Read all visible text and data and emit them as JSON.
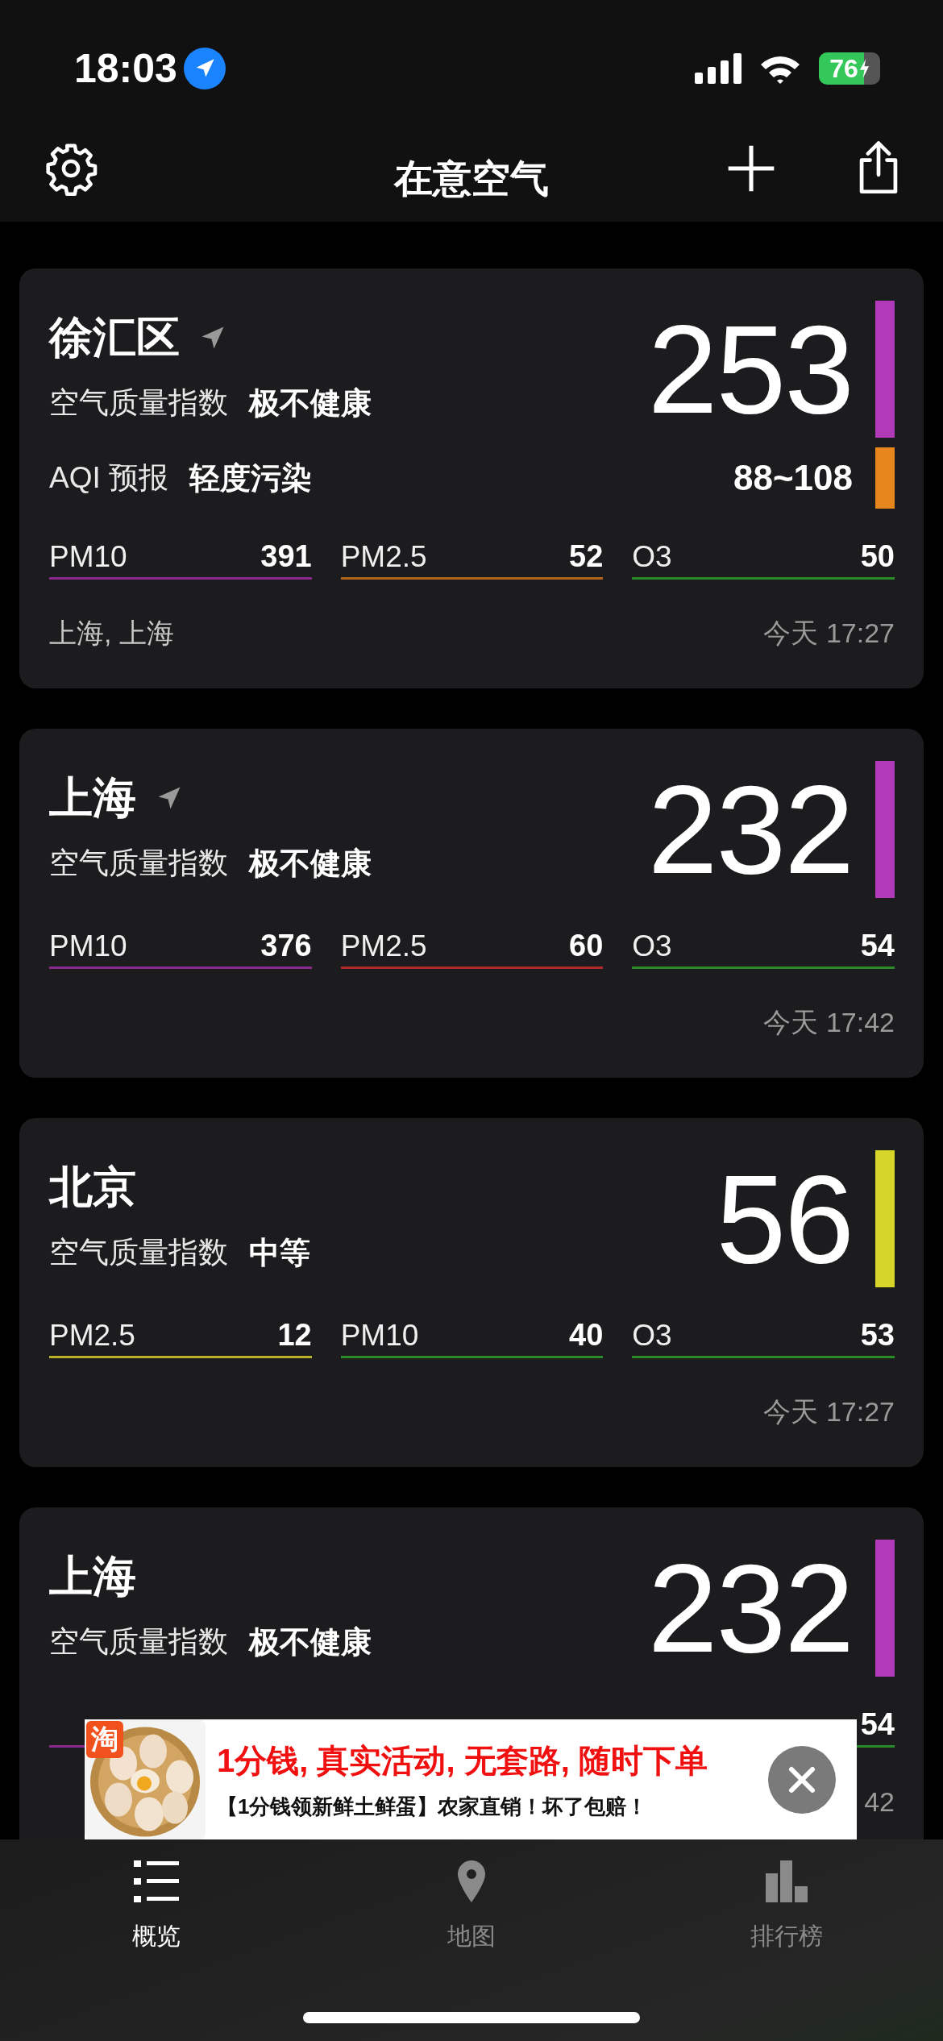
{
  "status_bar": {
    "time": "18:03",
    "battery": "76"
  },
  "nav": {
    "title": "在意空气"
  },
  "cards": [
    {
      "name": "徐汇区",
      "located": true,
      "aqi_label": "空气质量指数",
      "status": "极不健康",
      "value": "253",
      "color": "#b03ab8",
      "forecast": {
        "label": "AQI 预报",
        "status": "轻度污染",
        "range": "88~108",
        "color": "#e8861e"
      },
      "pollutants": [
        {
          "label": "PM10",
          "value": "391",
          "color": "#8a2a8e"
        },
        {
          "label": "PM2.5",
          "value": "52",
          "color": "#b0651a"
        },
        {
          "label": "O3",
          "value": "50",
          "color": "#2a8a2a"
        }
      ],
      "region": "上海, 上海",
      "time": "今天 17:27"
    },
    {
      "name": "上海",
      "located": true,
      "aqi_label": "空气质量指数",
      "status": "极不健康",
      "value": "232",
      "color": "#b03ab8",
      "pollutants": [
        {
          "label": "PM10",
          "value": "376",
          "color": "#8a2a8e"
        },
        {
          "label": "PM2.5",
          "value": "60",
          "color": "#b02a2a"
        },
        {
          "label": "O3",
          "value": "54",
          "color": "#2a8a2a"
        }
      ],
      "time": "今天 17:42"
    },
    {
      "name": "北京",
      "located": false,
      "aqi_label": "空气质量指数",
      "status": "中等",
      "value": "56",
      "color": "#d6d62a",
      "pollutants": [
        {
          "label": "PM2.5",
          "value": "12",
          "color": "#b8b02a"
        },
        {
          "label": "PM10",
          "value": "40",
          "color": "#2a8a2a"
        },
        {
          "label": "O3",
          "value": "53",
          "color": "#2a8a2a"
        }
      ],
      "time": "今天 17:27"
    },
    {
      "name": "上海",
      "located": false,
      "aqi_label": "空气质量指数",
      "status": "极不健康",
      "value": "232",
      "color": "#b03ab8",
      "pollutants": [
        {
          "color": "#8a2a8e"
        },
        {
          "value": "54",
          "color": "#2a8a2a"
        }
      ],
      "time": "42"
    }
  ],
  "ad": {
    "badge": "淘",
    "headline": "1分钱, 真实活动, 无套路, 随时下单",
    "text": "【1分钱领新鲜土鲜蛋】农家直销！坏了包赔！"
  },
  "tabs": [
    {
      "label": "概览",
      "kind": "list",
      "selected": true
    },
    {
      "label": "地图",
      "kind": "map",
      "selected": false
    },
    {
      "label": "排行榜",
      "kind": "ranking",
      "selected": false
    }
  ]
}
